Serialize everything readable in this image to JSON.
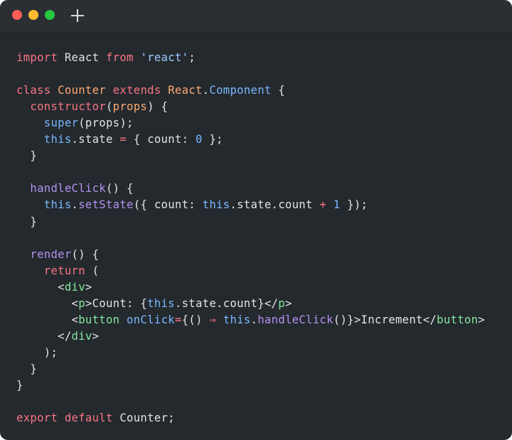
{
  "window": {
    "traffic_lights": [
      {
        "name": "close",
        "color": "#fe5f57"
      },
      {
        "name": "minimize",
        "color": "#febc2e"
      },
      {
        "name": "maximize",
        "color": "#28c840"
      }
    ],
    "new_tab_icon": "plus-icon"
  },
  "editor": {
    "language": "javascript",
    "theme_colors": {
      "background": "#24292e",
      "text": "#e1e4e8",
      "keyword": "#f97583",
      "class": "#ffab70",
      "string": "#9ecbff",
      "function": "#b392f0",
      "number": "#79b8ff",
      "tag": "#85e89d"
    },
    "lines": [
      [
        {
          "t": "import",
          "c": "keyword"
        },
        {
          "t": " React ",
          "c": "text"
        },
        {
          "t": "from",
          "c": "keyword"
        },
        {
          "t": " ",
          "c": "text"
        },
        {
          "t": "'react'",
          "c": "string"
        },
        {
          "t": ";",
          "c": "text"
        }
      ],
      [],
      [
        {
          "t": "class",
          "c": "keyword"
        },
        {
          "t": " ",
          "c": "text"
        },
        {
          "t": "Counter",
          "c": "class"
        },
        {
          "t": " ",
          "c": "text"
        },
        {
          "t": "extends",
          "c": "keyword"
        },
        {
          "t": " ",
          "c": "text"
        },
        {
          "t": "React",
          "c": "class"
        },
        {
          "t": ".",
          "c": "text"
        },
        {
          "t": "Component",
          "c": "number"
        },
        {
          "t": " {",
          "c": "text"
        }
      ],
      [
        {
          "t": "  ",
          "c": "text"
        },
        {
          "t": "constructor",
          "c": "keyword"
        },
        {
          "t": "(",
          "c": "text"
        },
        {
          "t": "props",
          "c": "class"
        },
        {
          "t": ") {",
          "c": "text"
        }
      ],
      [
        {
          "t": "    ",
          "c": "text"
        },
        {
          "t": "super",
          "c": "number"
        },
        {
          "t": "(props);",
          "c": "text"
        }
      ],
      [
        {
          "t": "    ",
          "c": "text"
        },
        {
          "t": "this",
          "c": "number"
        },
        {
          "t": ".state ",
          "c": "text"
        },
        {
          "t": "=",
          "c": "keyword"
        },
        {
          "t": " { count: ",
          "c": "text"
        },
        {
          "t": "0",
          "c": "number"
        },
        {
          "t": " };",
          "c": "text"
        }
      ],
      [
        {
          "t": "  }",
          "c": "text"
        }
      ],
      [],
      [
        {
          "t": "  ",
          "c": "text"
        },
        {
          "t": "handleClick",
          "c": "function"
        },
        {
          "t": "() {",
          "c": "text"
        }
      ],
      [
        {
          "t": "    ",
          "c": "text"
        },
        {
          "t": "this",
          "c": "number"
        },
        {
          "t": ".",
          "c": "text"
        },
        {
          "t": "setState",
          "c": "function"
        },
        {
          "t": "({ count: ",
          "c": "text"
        },
        {
          "t": "this",
          "c": "number"
        },
        {
          "t": ".state.count ",
          "c": "text"
        },
        {
          "t": "+",
          "c": "keyword"
        },
        {
          "t": " ",
          "c": "text"
        },
        {
          "t": "1",
          "c": "number"
        },
        {
          "t": " });",
          "c": "text"
        }
      ],
      [
        {
          "t": "  }",
          "c": "text"
        }
      ],
      [],
      [
        {
          "t": "  ",
          "c": "text"
        },
        {
          "t": "render",
          "c": "function"
        },
        {
          "t": "() {",
          "c": "text"
        }
      ],
      [
        {
          "t": "    ",
          "c": "text"
        },
        {
          "t": "return",
          "c": "keyword"
        },
        {
          "t": " (",
          "c": "text"
        }
      ],
      [
        {
          "t": "      <",
          "c": "text"
        },
        {
          "t": "div",
          "c": "tag"
        },
        {
          "t": ">",
          "c": "text"
        }
      ],
      [
        {
          "t": "        <",
          "c": "text"
        },
        {
          "t": "p",
          "c": "tag"
        },
        {
          "t": ">Count: {",
          "c": "text"
        },
        {
          "t": "this",
          "c": "number"
        },
        {
          "t": ".state.count}</",
          "c": "text"
        },
        {
          "t": "p",
          "c": "tag"
        },
        {
          "t": ">",
          "c": "text"
        }
      ],
      [
        {
          "t": "        <",
          "c": "text"
        },
        {
          "t": "button",
          "c": "tag"
        },
        {
          "t": " ",
          "c": "text"
        },
        {
          "t": "onClick",
          "c": "number"
        },
        {
          "t": "=",
          "c": "keyword"
        },
        {
          "t": "{() ",
          "c": "text"
        },
        {
          "t": "⇒",
          "c": "keyword"
        },
        {
          "t": " ",
          "c": "text"
        },
        {
          "t": "this",
          "c": "number"
        },
        {
          "t": ".",
          "c": "text"
        },
        {
          "t": "handleClick",
          "c": "function"
        },
        {
          "t": "()}>Increment</",
          "c": "text"
        },
        {
          "t": "button",
          "c": "tag"
        },
        {
          "t": ">",
          "c": "text"
        }
      ],
      [
        {
          "t": "      </",
          "c": "text"
        },
        {
          "t": "div",
          "c": "tag"
        },
        {
          "t": ">",
          "c": "text"
        }
      ],
      [
        {
          "t": "    );",
          "c": "text"
        }
      ],
      [
        {
          "t": "  }",
          "c": "text"
        }
      ],
      [
        {
          "t": "}",
          "c": "text"
        }
      ],
      [],
      [
        {
          "t": "export",
          "c": "keyword"
        },
        {
          "t": " ",
          "c": "text"
        },
        {
          "t": "default",
          "c": "keyword"
        },
        {
          "t": " Counter;",
          "c": "text"
        }
      ]
    ]
  }
}
